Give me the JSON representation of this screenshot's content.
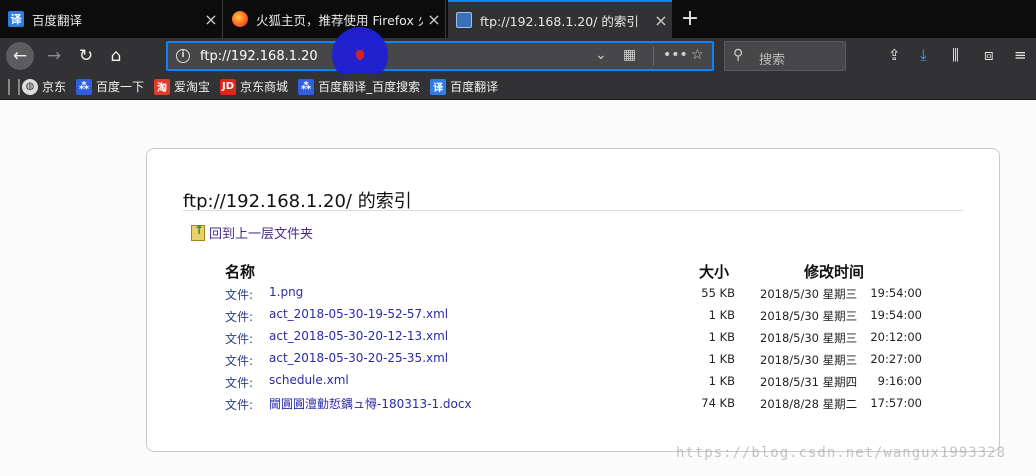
{
  "tabs": [
    {
      "title": "百度翻译",
      "icon": "fanyi-icon"
    },
    {
      "title": "火狐主页，推荐使用 Firefox 火",
      "icon": "firefox-icon"
    },
    {
      "title": "ftp://192.168.1.20/ 的索引",
      "icon": "ftp-icon",
      "active": true
    }
  ],
  "urlbar": {
    "url": "ftp://192.168.1.20"
  },
  "search": {
    "placeholder": "搜索"
  },
  "bookmarks": [
    {
      "label": "京东"
    },
    {
      "label": "百度一下"
    },
    {
      "label": "爱淘宝"
    },
    {
      "label": "京东商城"
    },
    {
      "label": "百度翻译_百度搜索"
    },
    {
      "label": "百度翻译"
    }
  ],
  "page": {
    "heading": "ftp://192.168.1.20/ 的索引",
    "up_link": "回到上一层文件夹",
    "columns": {
      "name": "名称",
      "size": "大小",
      "modified": "修改时间"
    },
    "rows": [
      {
        "kind": "文件:",
        "name": "1.png",
        "size": "55 KB",
        "date": "2018/5/30 星期三",
        "time": "19:54:00"
      },
      {
        "kind": "文件:",
        "name": "act_2018-05-30-19-52-57.xml",
        "size": "1 KB",
        "date": "2018/5/30 星期三",
        "time": "19:54:00"
      },
      {
        "kind": "文件:",
        "name": "act_2018-05-30-20-12-13.xml",
        "size": "1 KB",
        "date": "2018/5/30 星期三",
        "time": "20:12:00"
      },
      {
        "kind": "文件:",
        "name": "act_2018-05-30-20-25-35.xml",
        "size": "1 KB",
        "date": "2018/5/30 星期三",
        "time": "20:27:00"
      },
      {
        "kind": "文件:",
        "name": "schedule.xml",
        "size": "1 KB",
        "date": "2018/5/31 星期四",
        "time": "9:16:00"
      },
      {
        "kind": "文件:",
        "name": "閫圓圓澶勭悊鍝ュ憳-180313-1.docx",
        "size": "74 KB",
        "date": "2018/8/28 星期二",
        "time": "17:57:00"
      }
    ]
  },
  "watermark": "https://blog.csdn.net/wangux1993328",
  "colors": {
    "accent": "#0a84ff",
    "chrome_dark": "#0c0c0d",
    "toolbar": "#323234",
    "link": "#2a2aa8"
  }
}
